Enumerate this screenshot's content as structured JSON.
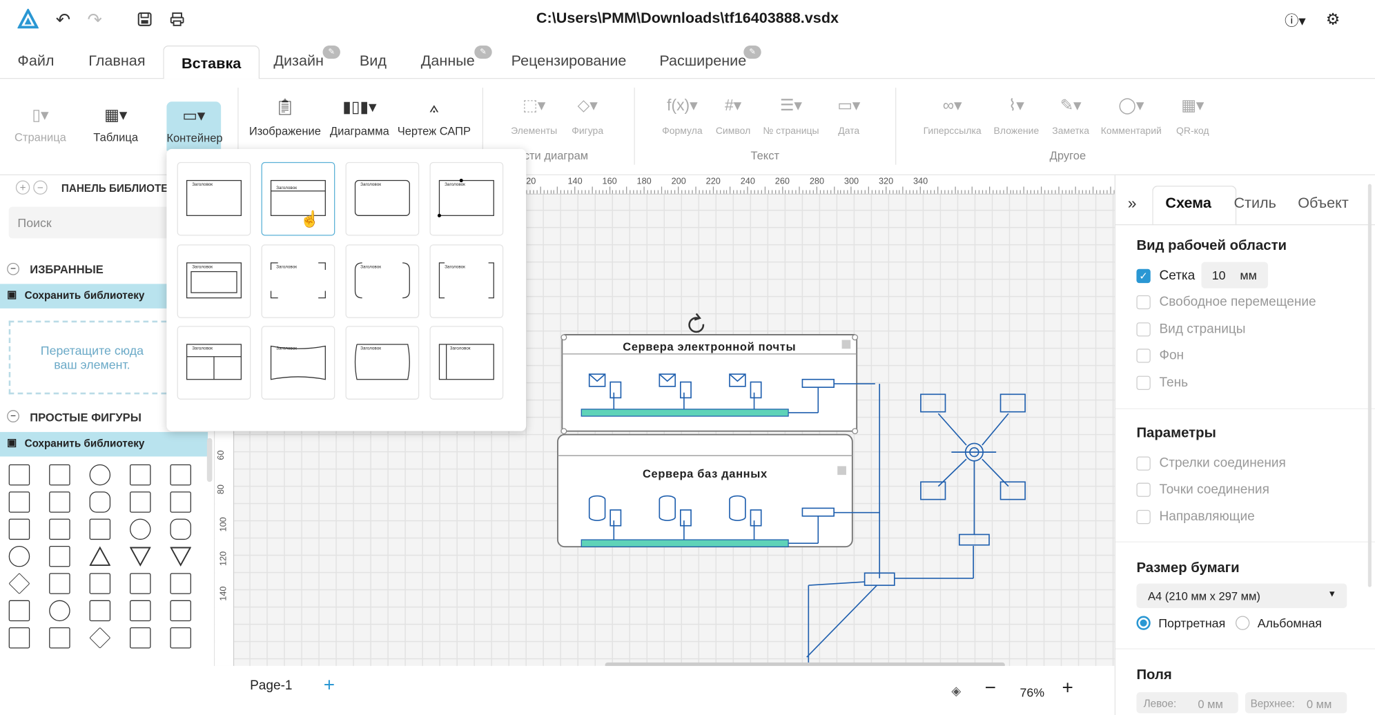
{
  "window": {
    "title": "C:\\Users\\PMM\\Downloads\\tf16403888.vsdx"
  },
  "tabs": [
    "Файл",
    "Главная",
    "Вставка",
    "Дизайн",
    "Вид",
    "Данные",
    "Рецензирование",
    "Расширение"
  ],
  "ribbon": {
    "page": "Страница",
    "table": "Таблица",
    "container": "Контейнер",
    "image": "Изображение",
    "chart": "Диаграмма",
    "cad": "Чертеж САПР",
    "elements": "Элементы",
    "figure": "Фигура",
    "group_parts": "асти диаграм",
    "formula": "Формула",
    "symbol": "Символ",
    "page_number": "№ страницы",
    "date": "Дата",
    "group_text": "Текст",
    "hyperlink": "Гиперссылка",
    "attachment": "Вложение",
    "note": "Заметка",
    "comment": "Комментарий",
    "qr": "QR-код",
    "group_other": "Другое"
  },
  "container_popup": {
    "cell_label": "Заголовок"
  },
  "library": {
    "header": "ПАНЕЛЬ БИБЛИОТЕК",
    "search_placeholder": "Поиск",
    "favorites": "ИЗБРАННЫЕ",
    "save_library": "Сохранить библиотеку",
    "drop_hint": "Перетащите сюда ваш элемент.",
    "simple_shapes": "ПРОСТЫЕ ФИГУРЫ"
  },
  "ruler": {
    "top": [
      "20",
      "140",
      "160",
      "180",
      "200",
      "220",
      "240",
      "260",
      "280",
      "300",
      "320",
      "340"
    ],
    "left": [
      "60",
      "80",
      "100",
      "120",
      "140"
    ]
  },
  "diagram": {
    "container1": "Сервера электронной почты",
    "container2": "Сервера баз данных"
  },
  "right_panel": {
    "tabs": [
      "Схема",
      "Стиль",
      "Объект"
    ],
    "workspace_title": "Вид рабочей области",
    "grid": "Сетка",
    "grid_value": "10",
    "grid_unit": "мм",
    "free_move": "Свободное перемещение",
    "page_view": "Вид страницы",
    "background": "Фон",
    "shadow": "Тень",
    "params_title": "Параметры",
    "conn_arrows": "Стрелки соединения",
    "conn_points": "Точки соединения",
    "guides": "Направляющие",
    "paper_title": "Размер бумаги",
    "paper_value": "A4 (210 мм x 297 мм)",
    "portrait": "Портретная",
    "landscape": "Альбомная",
    "margins_title": "Поля",
    "left_margin": "Левое:",
    "left_margin_value": "0 мм",
    "top_margin": "Верхнее:",
    "top_margin_value": "0 мм"
  },
  "bottom": {
    "page": "Page-1",
    "zoom": "76%"
  },
  "colors": {
    "accent": "#2a97d3",
    "selection": "#b9e3ee",
    "network": "#1f5fae",
    "bus": "#5fd3b8"
  }
}
